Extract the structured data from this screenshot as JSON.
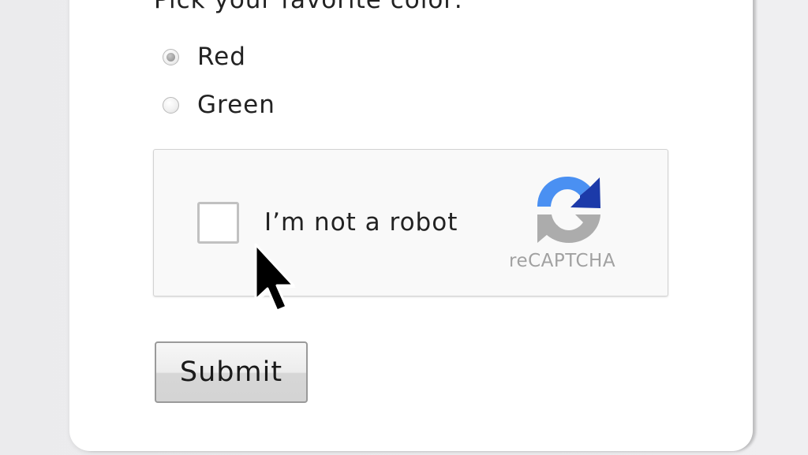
{
  "form": {
    "question": "Pick your favorite color:",
    "options": [
      {
        "label": "Red",
        "selected": true
      },
      {
        "label": "Green",
        "selected": false
      }
    ]
  },
  "recaptcha": {
    "checkbox_label": "I’m not a robot",
    "brand": "reCAPTCHA",
    "checked": false,
    "logo_icon": "recaptcha-logo-icon",
    "colors": {
      "blue_light": "#4a90f2",
      "blue_dark": "#1c3aa9",
      "gray": "#acacac"
    }
  },
  "submit": {
    "label": "Submit"
  },
  "cursor": {
    "icon": "mouse-pointer-icon"
  }
}
